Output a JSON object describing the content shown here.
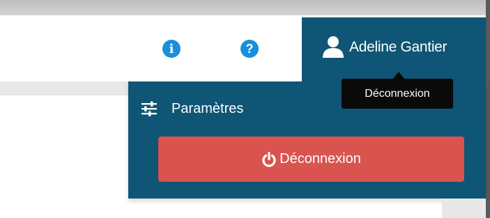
{
  "header": {
    "info_icon": "info-circle-icon",
    "help_icon": "question-circle-icon",
    "user": {
      "icon": "user-icon",
      "name": "Adeline Gantier"
    }
  },
  "user_menu": {
    "settings": {
      "icon": "sliders-icon",
      "label": "Paramètres"
    },
    "logout": {
      "icon": "power-icon",
      "label": "Déconnexion"
    }
  },
  "tooltip": {
    "text": "Déconnexion"
  },
  "colors": {
    "menu_background": "#0f5575",
    "logout_button": "#d9534f",
    "icon_blue": "#1a8fdb",
    "tooltip_background": "#0a0a0a"
  }
}
